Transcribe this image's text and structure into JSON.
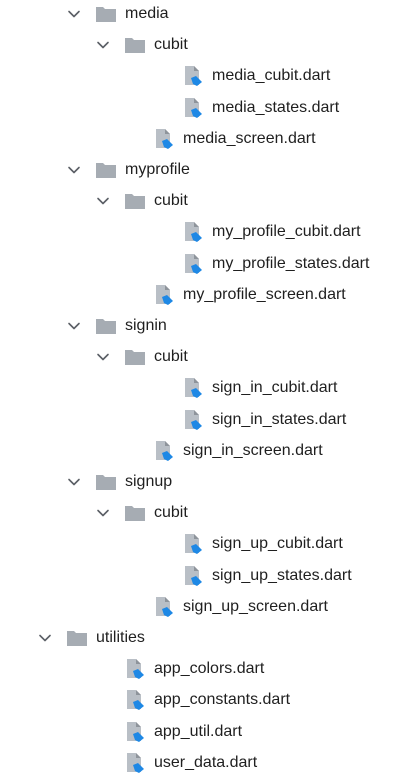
{
  "tree": {
    "items": [
      {
        "label": "media",
        "type": "folder",
        "level": 1,
        "expanded": true,
        "icon": "folder-icon"
      },
      {
        "label": "cubit",
        "type": "folder",
        "level": 2,
        "expanded": true,
        "icon": "folder-icon"
      },
      {
        "label": "media_cubit.dart",
        "type": "dart-file",
        "level": 3,
        "icon": "dart-file-icon"
      },
      {
        "label": "media_states.dart",
        "type": "dart-file",
        "level": 3,
        "icon": "dart-file-icon"
      },
      {
        "label": "media_screen.dart",
        "type": "dart-file",
        "level": 2,
        "icon": "dart-file-icon"
      },
      {
        "label": "myprofile",
        "type": "folder",
        "level": 1,
        "expanded": true,
        "icon": "folder-icon"
      },
      {
        "label": "cubit",
        "type": "folder",
        "level": 2,
        "expanded": true,
        "icon": "folder-icon"
      },
      {
        "label": "my_profile_cubit.dart",
        "type": "dart-file",
        "level": 3,
        "icon": "dart-file-icon"
      },
      {
        "label": "my_profile_states.dart",
        "type": "dart-file",
        "level": 3,
        "icon": "dart-file-icon"
      },
      {
        "label": "my_profile_screen.dart",
        "type": "dart-file",
        "level": 2,
        "icon": "dart-file-icon"
      },
      {
        "label": "signin",
        "type": "folder",
        "level": 1,
        "expanded": true,
        "icon": "folder-icon"
      },
      {
        "label": "cubit",
        "type": "folder",
        "level": 2,
        "expanded": true,
        "icon": "folder-icon"
      },
      {
        "label": "sign_in_cubit.dart",
        "type": "dart-file",
        "level": 3,
        "icon": "dart-file-icon"
      },
      {
        "label": "sign_in_states.dart",
        "type": "dart-file",
        "level": 3,
        "icon": "dart-file-icon"
      },
      {
        "label": "sign_in_screen.dart",
        "type": "dart-file",
        "level": 2,
        "icon": "dart-file-icon"
      },
      {
        "label": "signup",
        "type": "folder",
        "level": 1,
        "expanded": true,
        "icon": "folder-icon"
      },
      {
        "label": "cubit",
        "type": "folder",
        "level": 2,
        "expanded": true,
        "icon": "folder-icon"
      },
      {
        "label": "sign_up_cubit.dart",
        "type": "dart-file",
        "level": 3,
        "icon": "dart-file-icon"
      },
      {
        "label": "sign_up_states.dart",
        "type": "dart-file",
        "level": 3,
        "icon": "dart-file-icon"
      },
      {
        "label": "sign_up_screen.dart",
        "type": "dart-file",
        "level": 2,
        "icon": "dart-file-icon"
      },
      {
        "label": "utilities",
        "type": "folder",
        "level": 0,
        "expanded": true,
        "icon": "folder-icon"
      },
      {
        "label": "app_colors.dart",
        "type": "dart-file",
        "level": 1,
        "icon": "dart-file-icon"
      },
      {
        "label": "app_constants.dart",
        "type": "dart-file",
        "level": 1,
        "icon": "dart-file-icon"
      },
      {
        "label": "app_util.dart",
        "type": "dart-file",
        "level": 1,
        "icon": "dart-file-icon"
      },
      {
        "label": "user_data.dart",
        "type": "dart-file",
        "level": 1,
        "icon": "dart-file-icon"
      }
    ]
  },
  "colors": {
    "folder": "#a6acb3",
    "file_body": "#b9bfc6",
    "dart_blue": "#1e88e5",
    "chevron": "#5b5f66",
    "text": "#1f1f1f"
  }
}
